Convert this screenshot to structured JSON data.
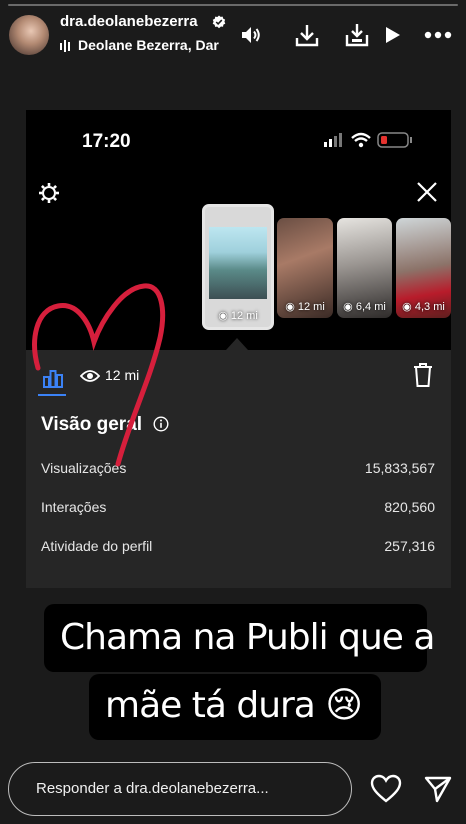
{
  "header": {
    "username": "dra.deolanebezerra",
    "audio_label": "Deolane Bezerra, Dar",
    "icons": [
      "volume-icon",
      "download-icon",
      "download-icon",
      "play-icon",
      "more-icon"
    ]
  },
  "screenshot": {
    "status_time": "17:20",
    "thumbnails": [
      {
        "views": "12 mi"
      },
      {
        "views": "12 mi"
      },
      {
        "views": "6,4 mi"
      },
      {
        "views": "4,3 mi"
      }
    ],
    "panel": {
      "views": "12 mi",
      "overview_title": "Visão geral",
      "stats": [
        {
          "label": "Visualizações",
          "value": "15,833,567"
        },
        {
          "label": "Interações",
          "value": "820,560"
        },
        {
          "label": "Atividade do perfil",
          "value": "257,316"
        }
      ]
    }
  },
  "caption": {
    "line1": "Chama na Publi que a",
    "line2": "mãe tá dura 😢"
  },
  "reply": {
    "placeholder": "Responder a dra.deolanebezerra..."
  },
  "colors": {
    "accent_blue": "#3b82f6",
    "heart_red": "#d61f3c",
    "panel_bg": "#262626"
  }
}
